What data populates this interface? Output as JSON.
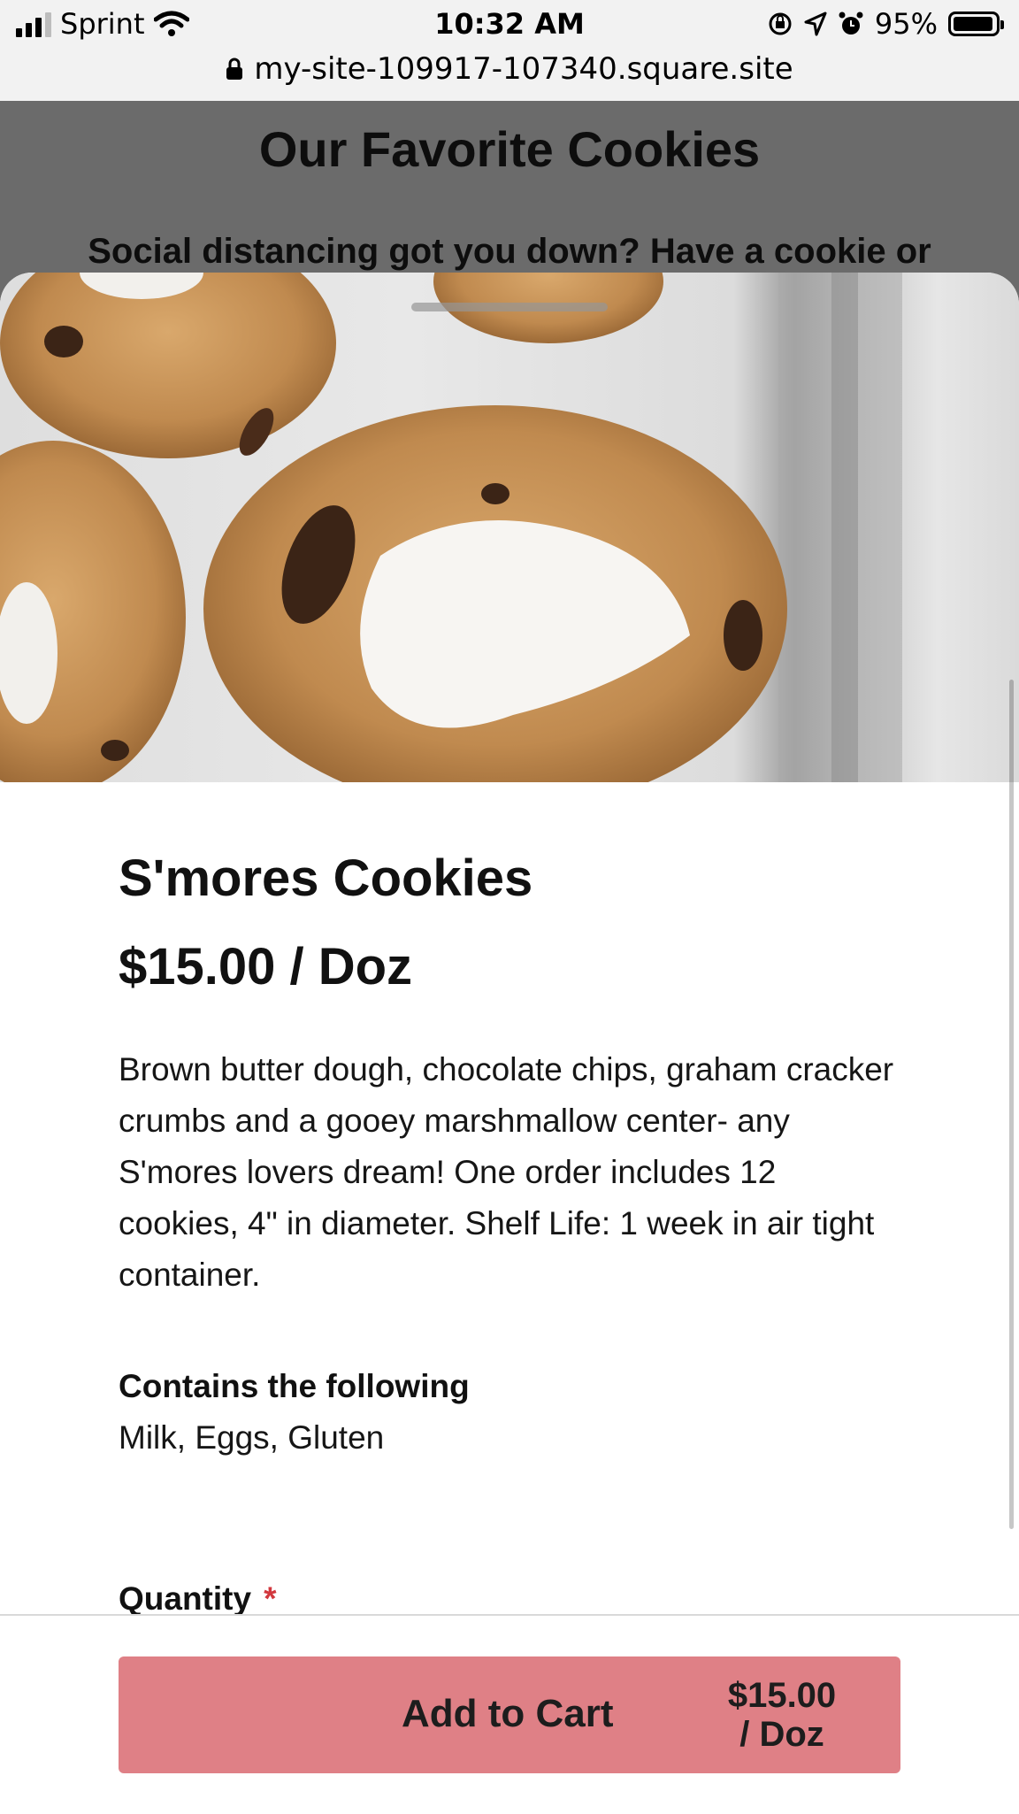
{
  "status_bar": {
    "carrier": "Sprint",
    "time": "10:32 AM",
    "battery": "95%",
    "battery_level": 0.95
  },
  "url_bar": {
    "url": "my-site-109917-107340.square.site"
  },
  "background_page": {
    "title": "Our Favorite Cookies",
    "subtitle": "Social distancing got you down? Have a cookie or"
  },
  "product": {
    "name": "S'mores Cookies",
    "price": "$15.00 / Doz",
    "description": "Brown butter dough, chocolate chips, graham cracker crumbs and a gooey marshmallow center- any S'mores lovers dream! One order includes 12 cookies, 4\" in diameter. Shelf Life: 1 week in air tight container.",
    "contains_label": "Contains the following",
    "contains_value": "Milk, Eggs, Gluten",
    "quantity_label": "Quantity",
    "required_marker": "*"
  },
  "footer": {
    "add_to_cart_label": "Add to Cart",
    "add_to_cart_price": "$15.00 / Doz"
  },
  "colors": {
    "button": "#df8086",
    "required": "#d2383e",
    "overlay": "#6b6b6b"
  },
  "icons": [
    "cellular-signal-icon",
    "wifi-icon",
    "lock-icon",
    "orientation-lock-icon",
    "location-arrow-icon",
    "alarm-icon",
    "battery-icon"
  ]
}
